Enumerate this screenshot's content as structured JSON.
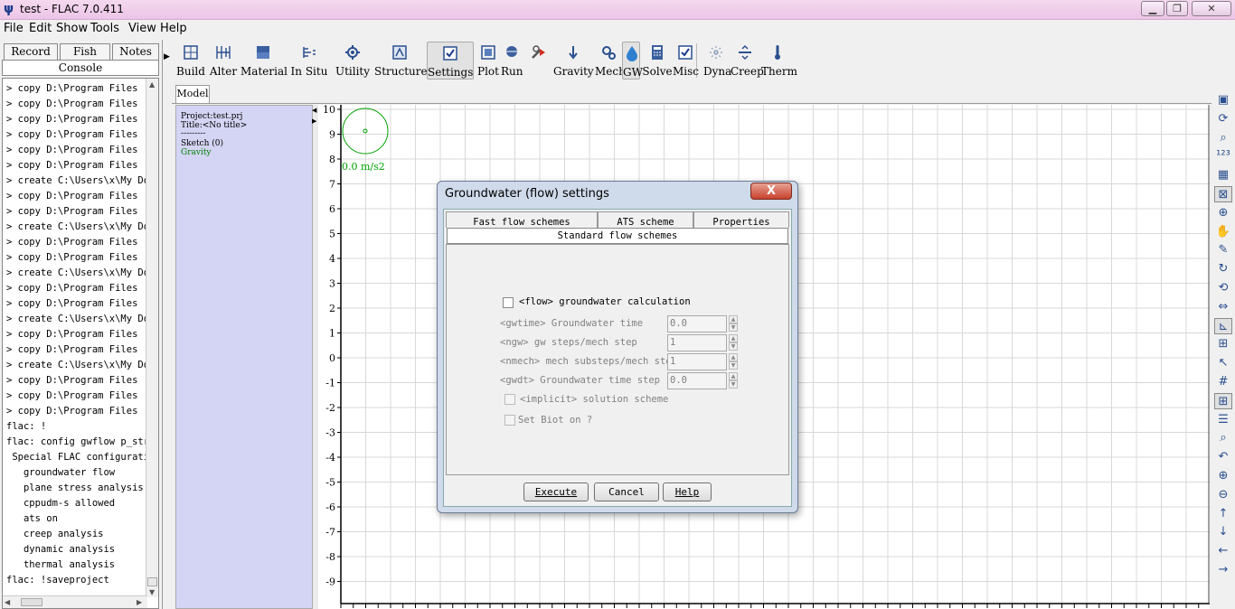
{
  "window": {
    "title": "test - FLAC 7.0.411",
    "icon": "flac-app-icon",
    "controls": [
      "minimize",
      "restore",
      "close"
    ]
  },
  "menu": [
    "File",
    "Edit",
    "Show",
    "Tools",
    "View",
    "Help"
  ],
  "left_panel": {
    "tabs": [
      "Record",
      "Fish",
      "Notes"
    ],
    "active_tab": "Console",
    "console_lines": [
      "> copy D:\\Program Files (x",
      "> copy D:\\Program Files (x",
      "> copy D:\\Program Files (x",
      "> copy D:\\Program Files (x",
      "> copy D:\\Program Files (x",
      "> copy D:\\Program Files (x",
      "> create C:\\Users\\x\\My Doc",
      "> copy D:\\Program Files (x",
      "> copy D:\\Program Files (x",
      "> create C:\\Users\\x\\My Doc",
      "> copy D:\\Program Files (x",
      "> copy D:\\Program Files (x",
      "> create C:\\Users\\x\\My Doc",
      "> copy D:\\Program Files (x",
      "> copy D:\\Program Files (x",
      "> create C:\\Users\\x\\My Doc",
      "> copy D:\\Program Files (x",
      "> copy D:\\Program Files (x",
      "> create C:\\Users\\x\\My Doc",
      "> copy D:\\Program Files (x",
      "> copy D:\\Program Files (x",
      "> copy D:\\Program Files (x",
      "flac: !",
      "flac: config gwflow p_stre",
      " Special FLAC configuratic",
      "   groundwater flow",
      "   plane stress analysis",
      "   cppudm-s allowed",
      "   ats on",
      "   creep analysis",
      "   dynamic analysis",
      "   thermal analysis",
      "flac: !saveproject"
    ]
  },
  "toolbar": {
    "buttons": [
      {
        "label": "Build",
        "icon": "build-grid-icon"
      },
      {
        "label": "Alter",
        "icon": "alter-grid-icon"
      },
      {
        "label": "Material",
        "icon": "material-icon"
      },
      {
        "label": "In Situ",
        "icon": "in-situ-icon"
      },
      {
        "label": "Utility",
        "icon": "utility-gear-icon"
      },
      {
        "label": "Structure",
        "icon": "structure-icon"
      },
      {
        "label": "Settings",
        "icon": "settings-check-icon",
        "active": true
      },
      {
        "label": "Plot",
        "icon": "plot-icon"
      },
      {
        "label": "Run",
        "icon": "run-icon"
      },
      {
        "label": "",
        "icon": "tools-config-icon"
      },
      {
        "label": "Gravity",
        "icon": "gravity-icon"
      },
      {
        "label": "Mech",
        "icon": "mech-gear-icon"
      },
      {
        "label": "GW",
        "icon": "groundwater-drop-icon",
        "active": true
      },
      {
        "label": "Solve",
        "icon": "solve-calculator-icon"
      },
      {
        "label": "Misc",
        "icon": "misc-check-icon"
      },
      {
        "label": "Dyna",
        "icon": "dynamic-icon"
      },
      {
        "label": "Creep",
        "icon": "creep-icon"
      },
      {
        "label": "Therm",
        "icon": "thermometer-icon"
      }
    ]
  },
  "model": {
    "tab": "Model",
    "info": [
      "Project:test.prj",
      "Title:<No title>",
      "---------",
      "Sketch (0)",
      "Gravity"
    ],
    "gravity_label": "0.0 m/s2",
    "y_ticks": [
      "10",
      "9",
      "8",
      "7",
      "6",
      "5",
      "4",
      "3",
      "2",
      "1",
      "0",
      "-1",
      "-2",
      "-3",
      "-4",
      "-5",
      "-6",
      "-7",
      "-8",
      "-9"
    ],
    "colors": {
      "panel_bg": "#d4d4f4",
      "gravity": "#00a000",
      "grid": "#d8d8d8"
    }
  },
  "dialog": {
    "title": "Groundwater (flow) settings",
    "close": "X",
    "tabs": [
      "Fast flow schemes",
      "ATS scheme",
      "Properties"
    ],
    "active_tab": "Standard flow schemes",
    "flow_checkbox": {
      "label": "<flow> groundwater calculation",
      "checked": false
    },
    "fields": [
      {
        "label": "<gwtime> Groundwater time",
        "value": "0.0"
      },
      {
        "label": "<ngw> gw steps/mech step",
        "value": "1"
      },
      {
        "label": "<nmech> mech substeps/mech step",
        "value": "1"
      },
      {
        "label": "<gwdt> Groundwater time step",
        "value": "0.0"
      }
    ],
    "implicit_checkbox": {
      "label": "<implicit> solution scheme",
      "checked": false
    },
    "biot_checkbox": {
      "label": "Set Biot on ?",
      "checked": false
    },
    "buttons": [
      "Execute",
      "Cancel",
      "Help"
    ]
  },
  "right_tools": [
    "save-icon",
    "refresh-icon",
    "print-preview-icon",
    "numbers-123-icon",
    "layout-icon",
    "close-view-icon",
    "zoom-icon",
    "pan-hand-icon",
    "edit-icon",
    "rotate-icon",
    "reset-view-icon",
    "link-icon",
    "axes-icon",
    "grid-icon",
    "pointer-icon",
    "grid-small-icon",
    "grid-axes-icon",
    "scroll-icon",
    "search-zoom-icon",
    "undo-icon",
    "zoom-in-icon",
    "zoom-out-icon",
    "arrow-up-icon",
    "arrow-down-icon",
    "arrow-left-icon",
    "arrow-right-icon"
  ]
}
